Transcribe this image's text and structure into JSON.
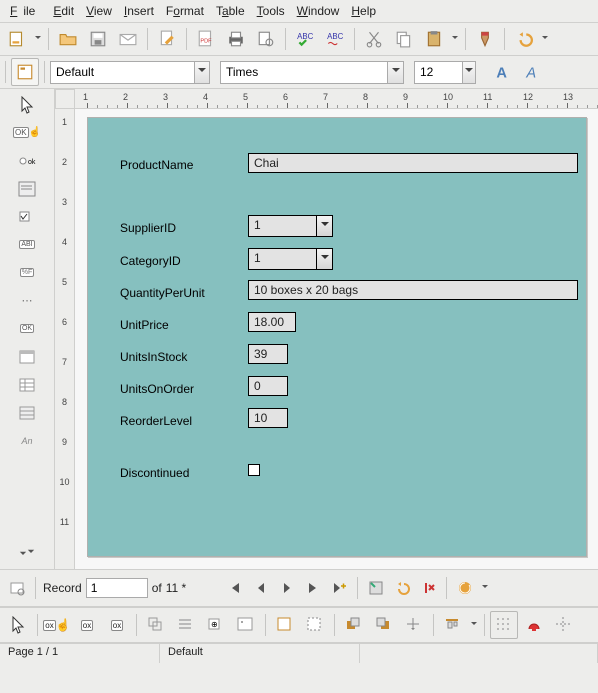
{
  "menu": {
    "file": "File",
    "edit": "Edit",
    "view": "View",
    "insert": "Insert",
    "format": "Format",
    "table": "Table",
    "tools": "Tools",
    "window": "Window",
    "help": "Help"
  },
  "fmt": {
    "style": "Default",
    "font": "Times",
    "size": "12"
  },
  "form": {
    "labels": {
      "productName": "ProductName",
      "supplierId": "SupplierID",
      "categoryId": "CategoryID",
      "qtyPerUnit": "QuantityPerUnit",
      "unitPrice": "UnitPrice",
      "unitsInStock": "UnitsInStock",
      "unitsOnOrder": "UnitsOnOrder",
      "reorderLevel": "ReorderLevel",
      "discontinued": "Discontinued"
    },
    "values": {
      "productName": "Chai",
      "supplierId": "1",
      "categoryId": "1",
      "qtyPerUnit": "10 boxes x 20 bags",
      "unitPrice": "18.00",
      "unitsInStock": "39",
      "unitsOnOrder": "0",
      "reorderLevel": "10",
      "discontinued": false
    }
  },
  "record": {
    "label": "Record",
    "current": "1",
    "of_label": "of",
    "total": "11 *"
  },
  "status": {
    "page": "Page 1 / 1",
    "style": "Default"
  },
  "ruler_h": [
    "1",
    "2",
    "3",
    "4",
    "5",
    "6",
    "7",
    "8",
    "9",
    "10",
    "11",
    "12",
    "13"
  ],
  "ruler_v": [
    "1",
    "2",
    "3",
    "4",
    "5",
    "6",
    "7",
    "8",
    "9",
    "10",
    "11"
  ]
}
